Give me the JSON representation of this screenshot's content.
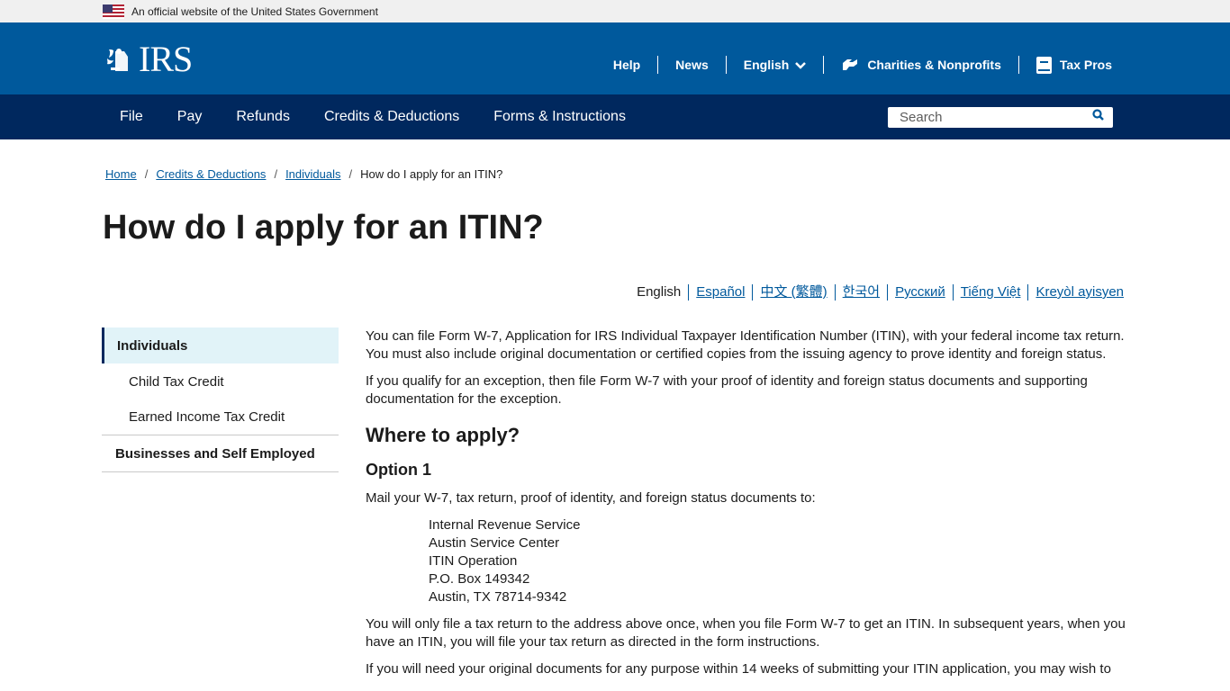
{
  "gov_banner": {
    "text": "An official website of the United States Government"
  },
  "header": {
    "logo_text": "IRS",
    "utility_nav": [
      {
        "label": "Help"
      },
      {
        "label": "News"
      },
      {
        "label": "English",
        "icon": "chevron-down-icon"
      },
      {
        "label": "Charities & Nonprofits",
        "icon": "handshake-icon"
      },
      {
        "label": "Tax Pros",
        "icon": "book-icon"
      }
    ]
  },
  "main_nav": {
    "items": [
      {
        "label": "File"
      },
      {
        "label": "Pay"
      },
      {
        "label": "Refunds"
      },
      {
        "label": "Credits & Deductions"
      },
      {
        "label": "Forms & Instructions"
      }
    ],
    "search": {
      "placeholder": "Search",
      "value": ""
    }
  },
  "breadcrumb": {
    "items": [
      {
        "label": "Home"
      },
      {
        "label": "Credits & Deductions"
      },
      {
        "label": "Individuals"
      }
    ],
    "current": "How do I apply for an ITIN?"
  },
  "page_title": "How do I apply for an ITIN?",
  "languages": {
    "current": "English",
    "links": [
      "Español",
      "中文 (繁體)",
      "한국어",
      "Русский",
      "Tiếng Việt",
      "Kreyòl ayisyen"
    ]
  },
  "sidebar": {
    "active": "Individuals",
    "sub_items": [
      "Child Tax Credit",
      "Earned Income Tax Credit"
    ],
    "top_items": [
      "Businesses and Self Employed"
    ]
  },
  "content": {
    "p1": "You can file Form W-7, Application for IRS Individual Taxpayer Identification Number (ITIN), with your federal income tax return. You must also include original documentation or certified copies from the issuing agency to prove identity and foreign status.",
    "p2": "If you qualify for an exception, then file Form W-7 with your proof of identity and foreign status documents and supporting documentation for the exception.",
    "h2": "Where to apply?",
    "h3": "Option 1",
    "p3": "Mail your W-7, tax return, proof of identity, and foreign status documents to:",
    "address": [
      "Internal Revenue Service",
      "Austin Service Center",
      "ITIN Operation",
      "P.O. Box 149342",
      "Austin, TX 78714-9342"
    ],
    "p4": "You will only file a tax return to the address above once, when you file Form W-7 to get an ITIN. In subsequent years, when you have an ITIN, you will file your tax return as directed in the form instructions.",
    "p5": "If you will need your original documents for any purpose within 14 weeks of submitting your ITIN application, you may wish to"
  }
}
